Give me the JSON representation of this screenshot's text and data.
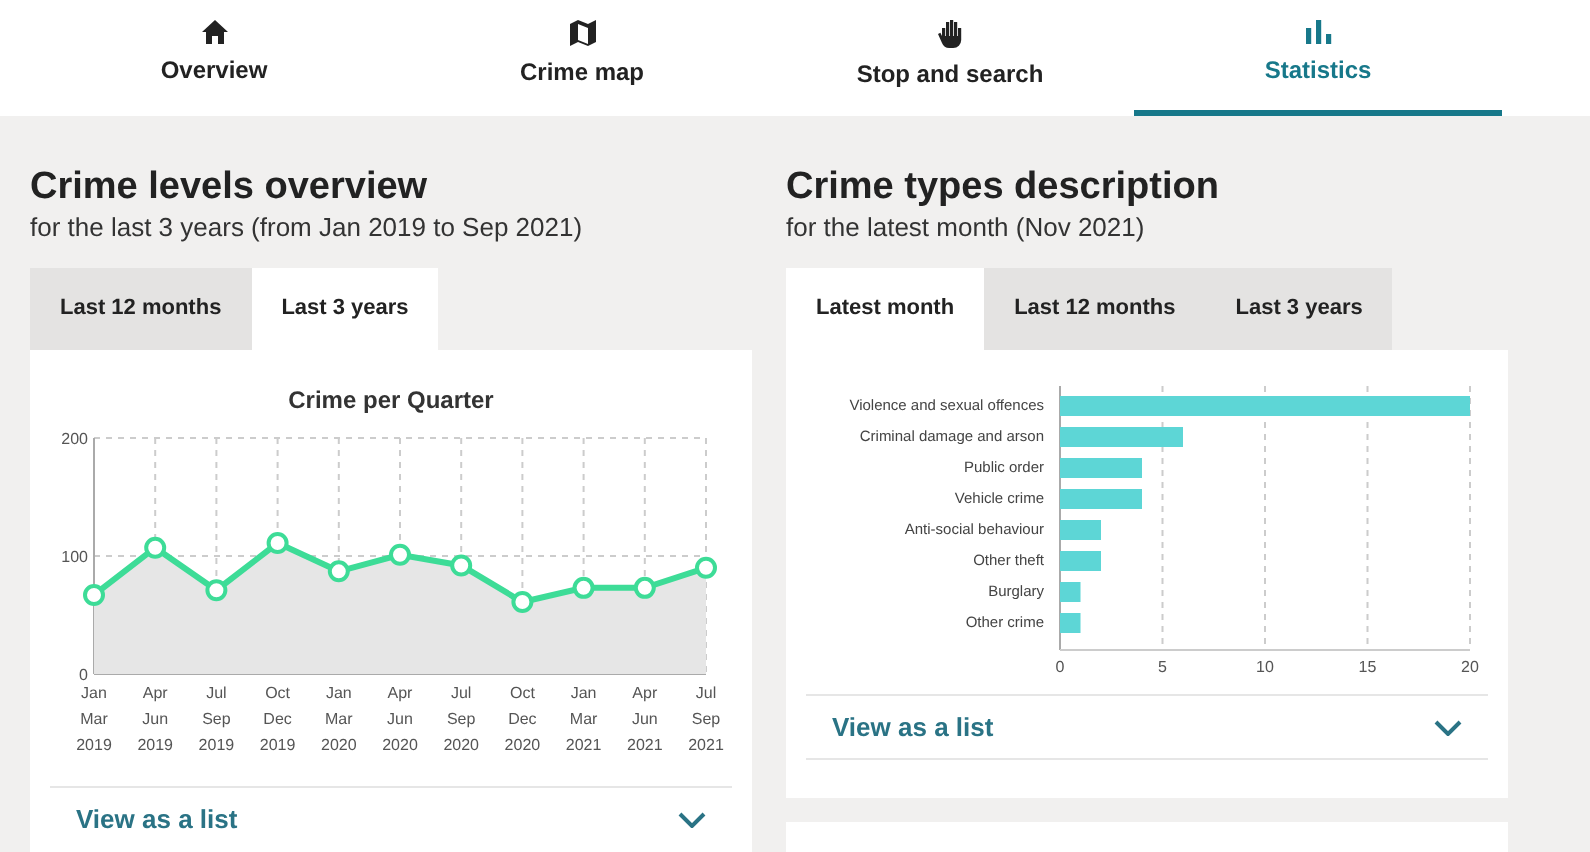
{
  "nav": [
    {
      "label": "Overview",
      "kind": "home",
      "selected": false
    },
    {
      "label": "Crime map",
      "kind": "map",
      "selected": false
    },
    {
      "label": "Stop and search",
      "kind": "hand",
      "selected": false
    },
    {
      "label": "Statistics",
      "kind": "chart",
      "selected": true
    }
  ],
  "panels": [
    {
      "title": "Crime levels overview",
      "subtitle": "for the last 3 years (from Jan 2019 to Sep 2021)",
      "tabs": [
        {
          "label": "Last 12 months",
          "selected": false
        },
        {
          "label": "Last 3 years",
          "selected": true
        }
      ],
      "link": "View as a list",
      "chart_data": {
        "type": "area",
        "title": "Crime per Quarter",
        "categories": [
          "Jan Mar 2019",
          "Apr Jun 2019",
          "Jul Sep 2019",
          "Oct Dec 2019",
          "Jan Mar 2020",
          "Apr Jun 2020",
          "Jul Sep 2020",
          "Oct Dec 2020",
          "Jan Mar 2021",
          "Apr Jun 2021",
          "Jul Sep 2021"
        ],
        "series": [
          {
            "color": "#3ddc97",
            "values": [
              67,
              107,
              71,
              111,
              87,
              101,
              92,
              61,
              73,
              73,
              90
            ]
          }
        ],
        "ylim": [
          0,
          200
        ],
        "yticks": [
          0,
          100,
          200
        ],
        "grid": true
      }
    },
    {
      "title": "Crime types description",
      "subtitle": "for the latest month (Nov 2021)",
      "tabs": [
        {
          "label": "Latest month",
          "selected": true
        },
        {
          "label": "Last 12 months",
          "selected": false
        },
        {
          "label": "Last 3 years",
          "selected": false
        }
      ],
      "link": "View as a list",
      "chart_data": {
        "type": "bar",
        "orientation": "horizontal",
        "categories": [
          "Violence and sexual offences",
          "Criminal damage and arson",
          "Public order",
          "Vehicle crime",
          "Anti-social behaviour",
          "Other theft",
          "Burglary",
          "Other crime"
        ],
        "series": [
          {
            "color": "#5dd6d6",
            "values": [
              20,
              6,
              4,
              4,
              2,
              2,
              1,
              1
            ]
          }
        ],
        "xlim": [
          0,
          20
        ],
        "xticks": [
          0,
          5,
          10,
          15,
          20
        ],
        "grid": true
      }
    }
  ]
}
